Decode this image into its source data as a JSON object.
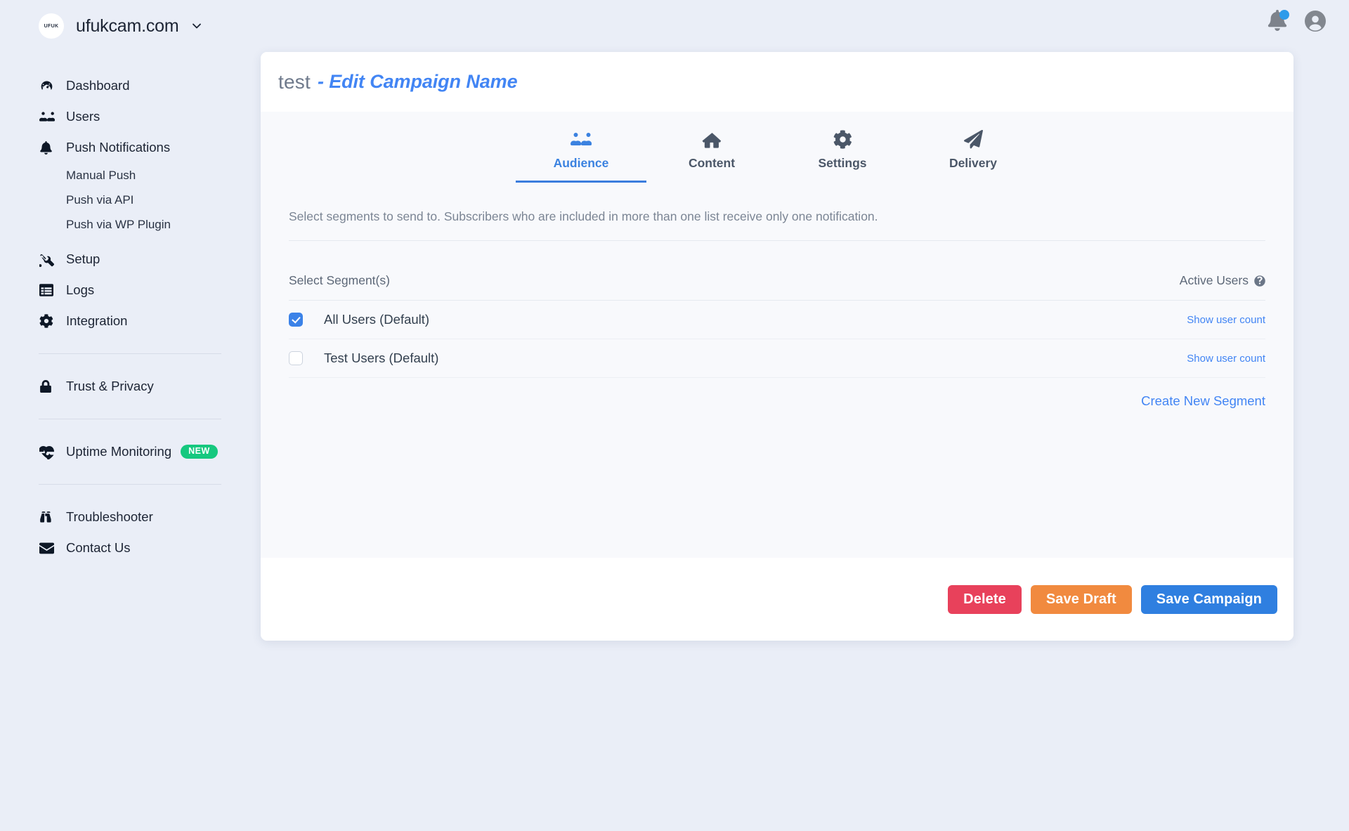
{
  "brand": {
    "logo_text": "UFUK",
    "name": "ufukcam.com",
    "caret_icon": "chevron-down-icon"
  },
  "topbar": {
    "notifications_icon": "bell-icon",
    "has_unread_dot": true,
    "account_icon": "user-avatar-icon"
  },
  "sidebar": {
    "items": [
      {
        "label": "Dashboard",
        "icon": "dashboard-gauge-icon"
      },
      {
        "label": "Users",
        "icon": "users-group-icon"
      },
      {
        "label": "Push Notifications",
        "icon": "bell-icon"
      },
      {
        "label": "Setup",
        "icon": "tools-wrench-icon"
      },
      {
        "label": "Logs",
        "icon": "list-table-icon"
      },
      {
        "label": "Integration",
        "icon": "gear-icon"
      },
      {
        "label": "Trust & Privacy",
        "icon": "lock-icon"
      },
      {
        "label": "Uptime Monitoring",
        "icon": "heartbeat-icon",
        "badge": "NEW"
      },
      {
        "label": "Troubleshooter",
        "icon": "binoculars-icon"
      },
      {
        "label": "Contact Us",
        "icon": "envelope-icon"
      }
    ],
    "push_subitems": [
      {
        "label": "Manual Push"
      },
      {
        "label": "Push via API"
      },
      {
        "label": "Push via WP Plugin"
      }
    ]
  },
  "card": {
    "header": {
      "campaign_name": "test",
      "edit_link": "- Edit Campaign Name"
    },
    "tabs": [
      {
        "label": "Audience",
        "icon": "users-group-icon",
        "active": true
      },
      {
        "label": "Content",
        "icon": "home-icon",
        "active": false
      },
      {
        "label": "Settings",
        "icon": "gear-icon",
        "active": false
      },
      {
        "label": "Delivery",
        "icon": "paper-plane-icon",
        "active": false
      }
    ],
    "description": "Select segments to send to. Subscribers who are included in more than one list receive only one notification.",
    "segment_table": {
      "col_segments": "Select Segment(s)",
      "col_active_users": "Active Users",
      "help_icon": "question-circle-icon",
      "rows": [
        {
          "label": "All Users (Default)",
          "checked": true,
          "action": "Show user count"
        },
        {
          "label": "Test Users (Default)",
          "checked": false,
          "action": "Show user count"
        }
      ],
      "create_link": "Create New Segment"
    },
    "footer": {
      "delete_label": "Delete",
      "draft_label": "Save Draft",
      "save_label": "Save Campaign"
    }
  },
  "colors": {
    "accent_blue": "#3b82e8",
    "link_blue": "#4285f4",
    "badge_green": "#16c87f",
    "delete_red": "#e8415b",
    "draft_orange": "#f18a3f",
    "save_blue": "#2f7fe0",
    "page_bg": "#eaeef7"
  }
}
